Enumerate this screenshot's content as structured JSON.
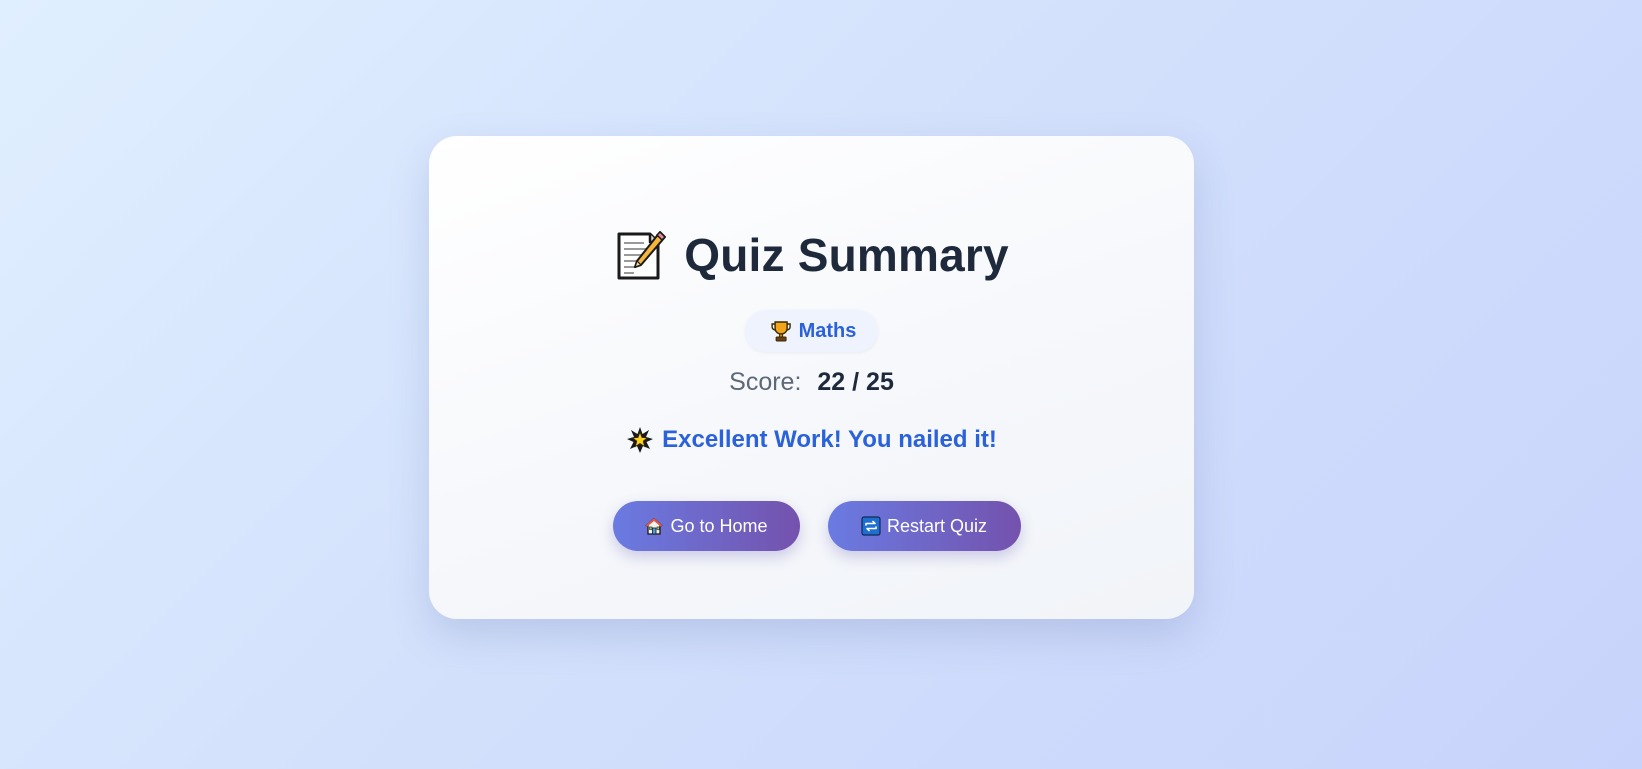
{
  "summary": {
    "title": "Quiz Summary",
    "title_icon": "memo-icon",
    "subject": {
      "icon": "trophy-icon",
      "label": "Maths"
    },
    "score": {
      "label": "Score:",
      "value": "22 / 25",
      "correct": 22,
      "total": 25
    },
    "message": {
      "icon": "star-burst-icon",
      "text": "Excellent Work! You nailed it!"
    }
  },
  "actions": {
    "home": {
      "icon": "house-icon",
      "label": "Go to Home"
    },
    "restart": {
      "icon": "repeat-icon",
      "label": "Restart Quiz"
    }
  },
  "colors": {
    "accent": "#2b62d9",
    "heading": "#1e2a3b",
    "muted": "#5d6878",
    "button_start": "#6a7be2",
    "button_end": "#7452ad"
  }
}
